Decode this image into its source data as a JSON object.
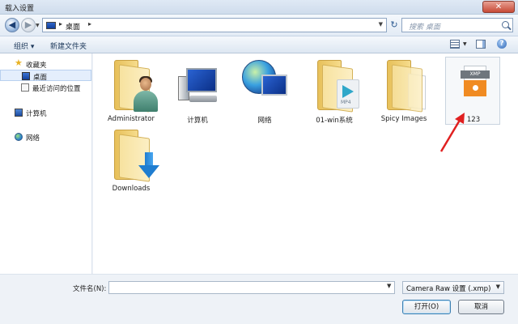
{
  "window": {
    "title": "载入设置",
    "close_glyph": "✕"
  },
  "nav": {
    "back_glyph": "◀",
    "forward_glyph": "▶",
    "address": {
      "location": "桌面",
      "separator": "▸",
      "after": "▸"
    },
    "refresh_glyph": "↻",
    "search_placeholder": "搜索 桌面"
  },
  "toolbar": {
    "organize": "组织 ▾",
    "new_folder": "新建文件夹",
    "help_glyph": "?"
  },
  "sidebar": {
    "items": [
      {
        "label": "收藏夹",
        "icon": "star-icon"
      },
      {
        "label": "桌面",
        "icon": "desktop-icon",
        "selected": true
      },
      {
        "label": "最近访问的位置",
        "icon": "recent-icon"
      },
      {
        "label": "计算机",
        "icon": "computer-icon"
      },
      {
        "label": "网络",
        "icon": "network-icon"
      }
    ]
  },
  "files": [
    {
      "label": "Administrator",
      "icon": "user-folder-icon"
    },
    {
      "label": "计算机",
      "icon": "computer-icon"
    },
    {
      "label": "网络",
      "icon": "network-icon"
    },
    {
      "label": "01-win系统",
      "icon": "video-folder-icon"
    },
    {
      "label": "Spicy Images",
      "icon": "document-folder-icon"
    },
    {
      "label": "123",
      "icon": "xmp-file-icon",
      "selected": true
    },
    {
      "label": "Downloads",
      "icon": "downloads-folder-icon"
    }
  ],
  "xmp_tag": "XMP",
  "mp4_tag": "MP4",
  "bottom": {
    "filename_label": "文件名(N):",
    "filename_value": "",
    "filetype": "Camera Raw 设置 (.xmp)",
    "open_button": "打开(O)",
    "cancel_button": "取消"
  },
  "colors": {
    "accent": "#2b64b4",
    "annotation_arrow": "#e02020"
  }
}
